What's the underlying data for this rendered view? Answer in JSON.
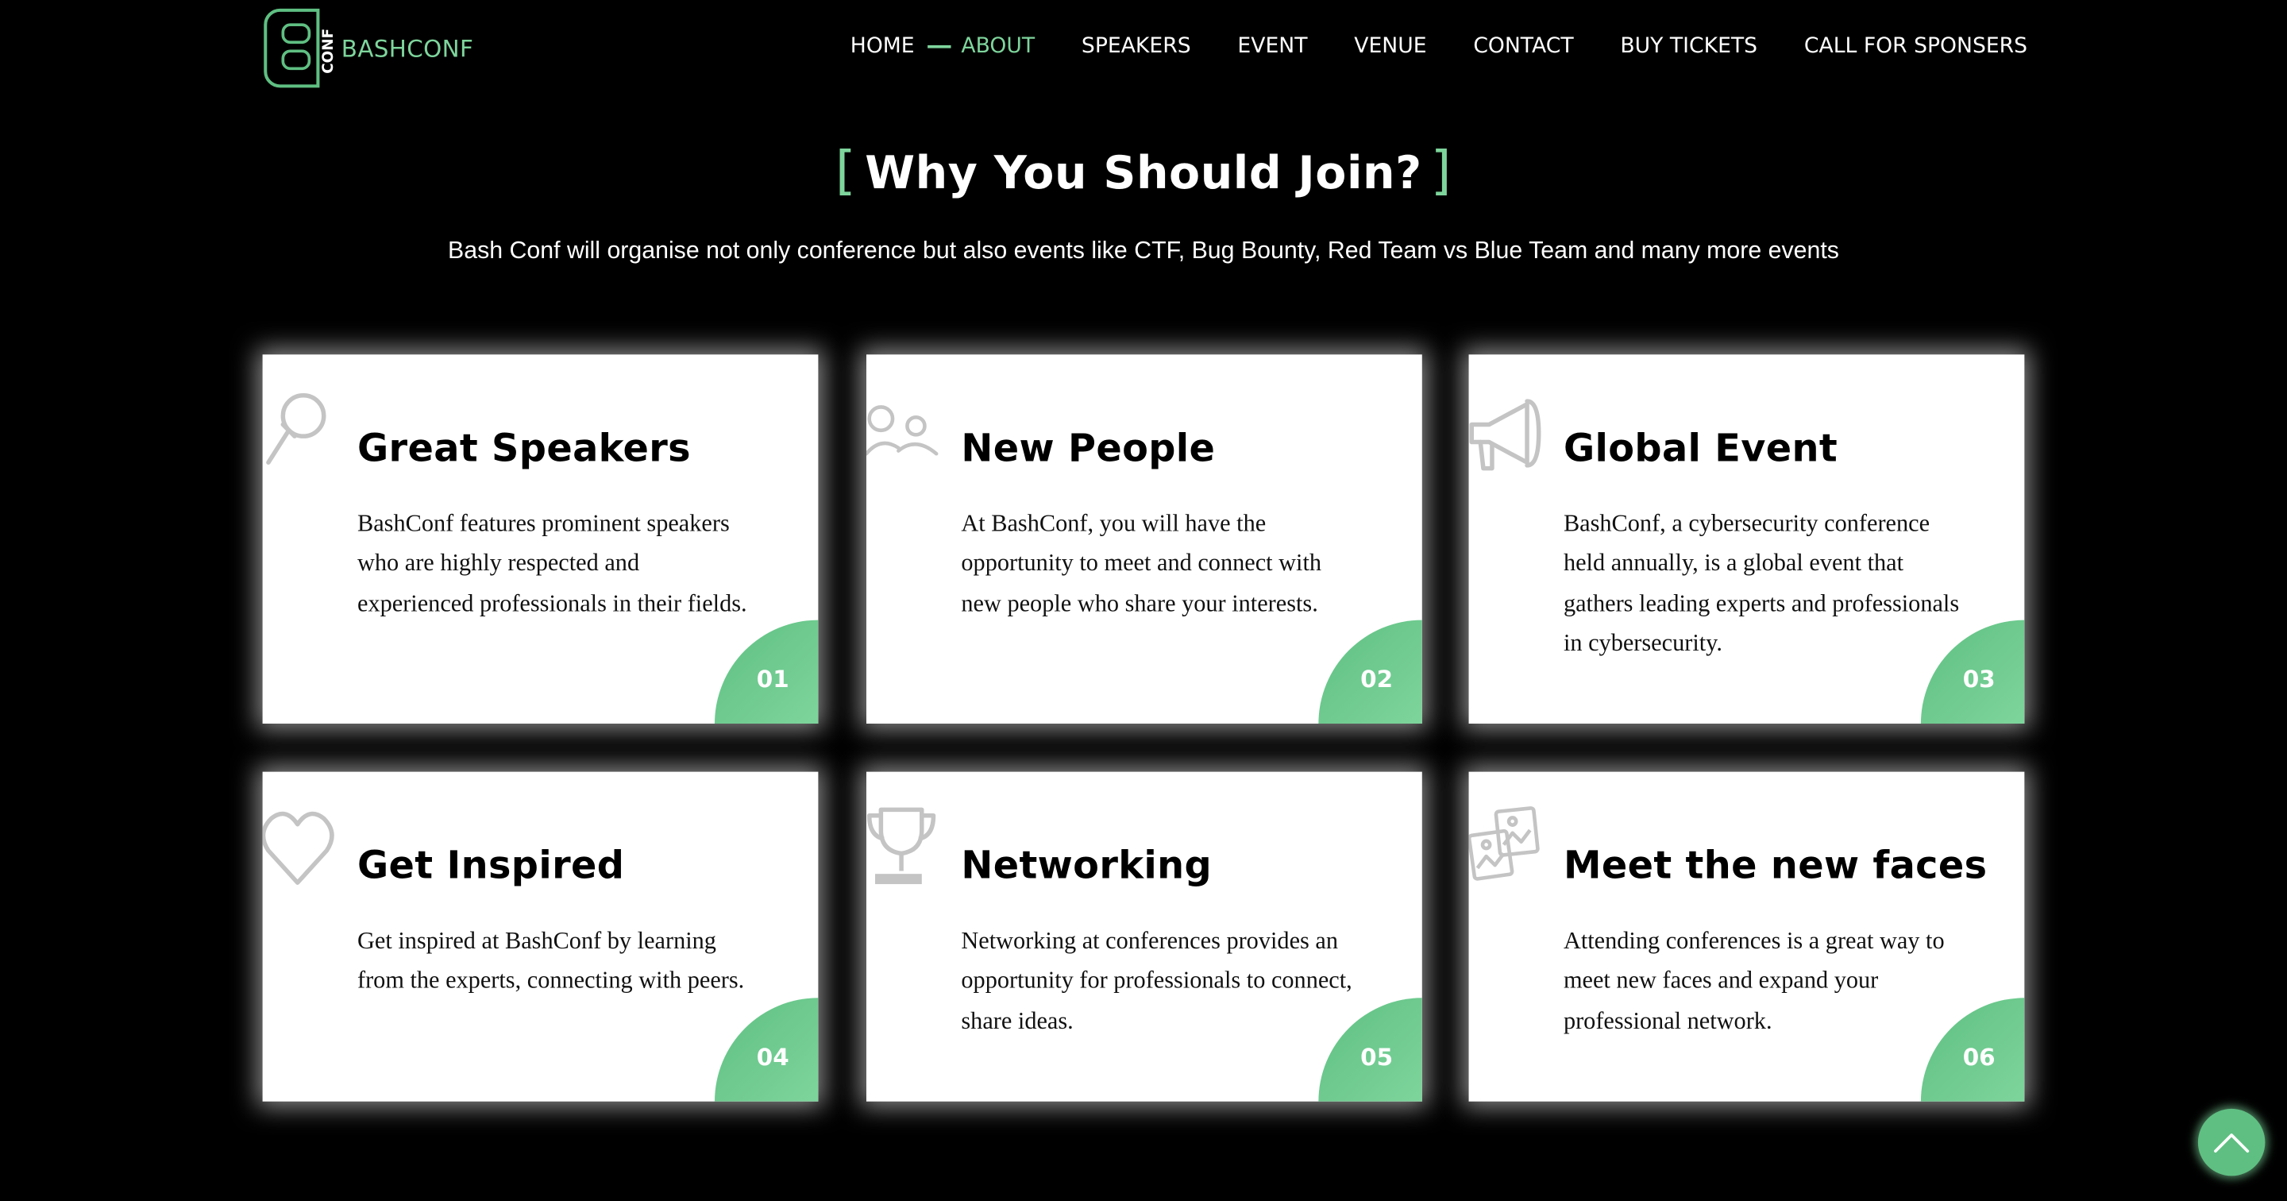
{
  "brand": {
    "logo_text": "BASHCONF",
    "logo_mark_text": "CONF",
    "accent_color": "#7ed59c"
  },
  "nav": {
    "items": [
      {
        "label": "HOME"
      },
      {
        "label": "ABOUT",
        "active": true
      },
      {
        "label": "SPEAKERS"
      },
      {
        "label": "EVENT"
      },
      {
        "label": "VENUE"
      },
      {
        "label": "CONTACT"
      },
      {
        "label": "BUY TICKETS"
      },
      {
        "label": "CALL FOR SPONSERS"
      }
    ]
  },
  "section": {
    "bracket_open": "[",
    "title": "Why You Should Join?",
    "bracket_close": "]",
    "subtitle": "Bash Conf will organise not only conference but also events like CTF, Bug Bounty, Red Team vs Blue Team and many more events"
  },
  "cards": [
    {
      "icon": "microphone-icon",
      "title": "Great Speakers",
      "text": "BashConf features prominent speakers who are highly respected and experienced professionals in their fields.",
      "number": "01"
    },
    {
      "icon": "people-icon",
      "title": "New People",
      "text": "At BashConf, you will have the opportunity to meet and connect with new people who share your interests.",
      "number": "02"
    },
    {
      "icon": "megaphone-icon",
      "title": "Global Event",
      "text": "BashConf, a cybersecurity conference held annually, is a global event that gathers leading experts and professionals in cybersecurity.",
      "number": "03"
    },
    {
      "icon": "heart-icon",
      "title": "Get Inspired",
      "text": "Get inspired at BashConf by learning from the experts, connecting with peers.",
      "number": "04"
    },
    {
      "icon": "trophy-icon",
      "title": "Networking",
      "text": "Networking at conferences provides an opportunity for professionals to connect, share ideas.",
      "number": "05"
    },
    {
      "icon": "photos-icon",
      "title": "Meet the new faces",
      "text": "Attending conferences is a great way to meet new faces and expand your professional network.",
      "number": "06"
    }
  ],
  "scroll_top": {
    "icon": "chevron-up-icon"
  }
}
